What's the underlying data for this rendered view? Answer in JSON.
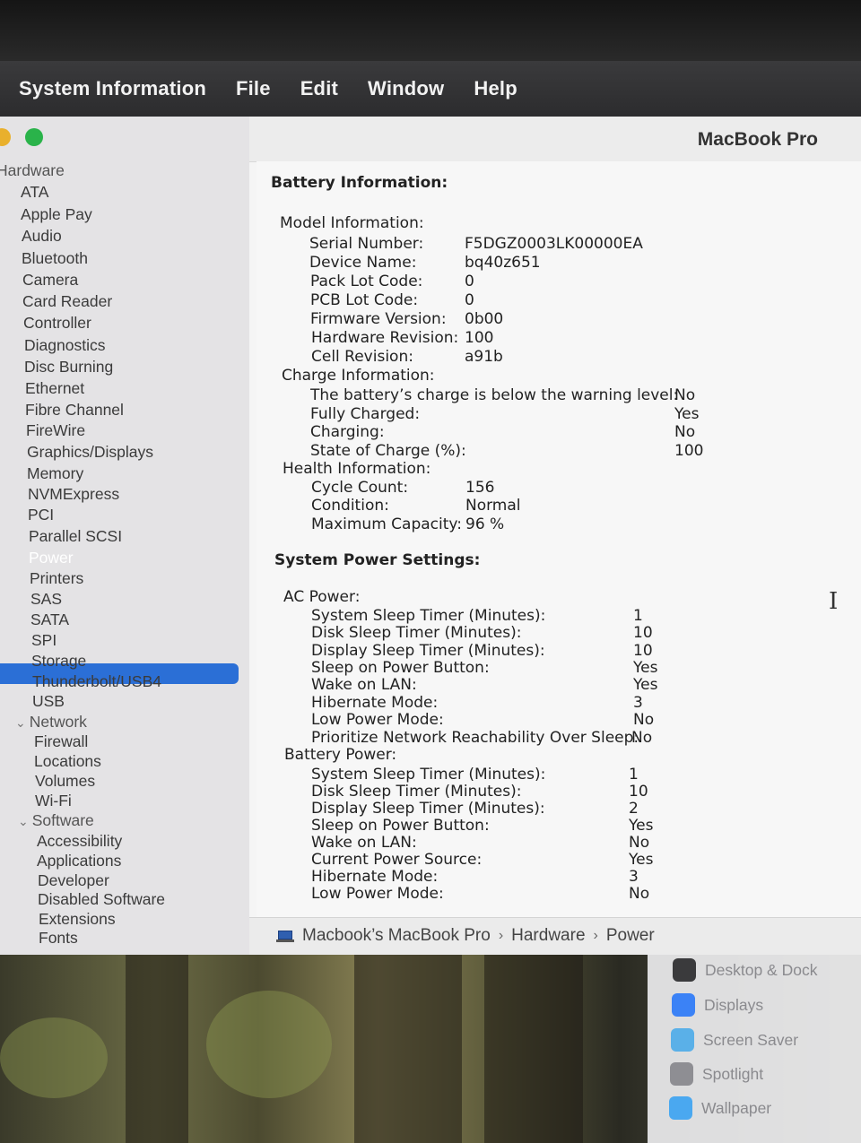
{
  "menubar": {
    "app_name": "System Information",
    "menus": [
      "File",
      "Edit",
      "Window",
      "Help"
    ]
  },
  "window": {
    "title": "MacBook Pro"
  },
  "sidebar": {
    "items": [
      {
        "label": "Hardware",
        "kind": "category"
      },
      {
        "label": "ATA"
      },
      {
        "label": "Apple Pay"
      },
      {
        "label": "Audio"
      },
      {
        "label": "Bluetooth"
      },
      {
        "label": "Camera"
      },
      {
        "label": "Card Reader"
      },
      {
        "label": "Controller"
      },
      {
        "label": "Diagnostics"
      },
      {
        "label": "Disc Burning"
      },
      {
        "label": "Ethernet"
      },
      {
        "label": "Fibre Channel"
      },
      {
        "label": "FireWire"
      },
      {
        "label": "Graphics/Displays"
      },
      {
        "label": "Memory"
      },
      {
        "label": "NVMExpress"
      },
      {
        "label": "PCI"
      },
      {
        "label": "Parallel SCSI"
      },
      {
        "label": "Power",
        "selected": true
      },
      {
        "label": "Printers"
      },
      {
        "label": "SAS"
      },
      {
        "label": "SATA"
      },
      {
        "label": "SPI"
      },
      {
        "label": "Storage"
      },
      {
        "label": "Thunderbolt/USB4"
      },
      {
        "label": "USB"
      },
      {
        "label": "Network",
        "kind": "category"
      },
      {
        "label": "Firewall"
      },
      {
        "label": "Locations"
      },
      {
        "label": "Volumes"
      },
      {
        "label": "Wi-Fi"
      },
      {
        "label": "Software",
        "kind": "category"
      },
      {
        "label": "Accessibility"
      },
      {
        "label": "Applications"
      },
      {
        "label": "Developer"
      },
      {
        "label": "Disabled Software"
      },
      {
        "label": "Extensions"
      },
      {
        "label": "Fonts"
      }
    ]
  },
  "battery": {
    "header": "Battery Information:",
    "model_header": "Model Information:",
    "model": [
      {
        "label": "Serial Number:",
        "value": "F5DGZ0003LK00000EA"
      },
      {
        "label": "Device Name:",
        "value": "bq40z651"
      },
      {
        "label": "Pack Lot Code:",
        "value": "0"
      },
      {
        "label": "PCB Lot Code:",
        "value": "0"
      },
      {
        "label": "Firmware Version:",
        "value": "0b00"
      },
      {
        "label": "Hardware Revision:",
        "value": "100"
      },
      {
        "label": "Cell Revision:",
        "value": "a91b"
      }
    ],
    "charge_header": "Charge Information:",
    "charge": [
      {
        "label": "The battery’s charge is below the warning level:",
        "value": "No"
      },
      {
        "label": "Fully Charged:",
        "value": "Yes"
      },
      {
        "label": "Charging:",
        "value": "No"
      },
      {
        "label": "State of Charge (%):",
        "value": "100"
      }
    ],
    "health_header": "Health Information:",
    "health": [
      {
        "label": "Cycle Count:",
        "value": "156"
      },
      {
        "label": "Condition:",
        "value": "Normal"
      },
      {
        "label": "Maximum Capacity:",
        "value": "96 %"
      }
    ]
  },
  "power": {
    "header": "System Power Settings:",
    "ac_header": "AC Power:",
    "ac": [
      {
        "label": "System Sleep Timer (Minutes):",
        "value": "1"
      },
      {
        "label": "Disk Sleep Timer (Minutes):",
        "value": "10"
      },
      {
        "label": "Display Sleep Timer (Minutes):",
        "value": "10"
      },
      {
        "label": "Sleep on Power Button:",
        "value": "Yes"
      },
      {
        "label": "Wake on LAN:",
        "value": "Yes"
      },
      {
        "label": "Hibernate Mode:",
        "value": "3"
      },
      {
        "label": "Low Power Mode:",
        "value": "No"
      },
      {
        "label": "Prioritize Network Reachability Over Sleep:",
        "value": "No"
      }
    ],
    "battery_header": "Battery Power:",
    "battery": [
      {
        "label": "System Sleep Timer (Minutes):",
        "value": "1"
      },
      {
        "label": "Disk Sleep Timer (Minutes):",
        "value": "10"
      },
      {
        "label": "Display Sleep Timer (Minutes):",
        "value": "2"
      },
      {
        "label": "Sleep on Power Button:",
        "value": "Yes"
      },
      {
        "label": "Wake on LAN:",
        "value": "No"
      },
      {
        "label": "Current Power Source:",
        "value": "Yes"
      },
      {
        "label": "Hibernate Mode:",
        "value": "3"
      },
      {
        "label": "Low Power Mode:",
        "value": "No"
      }
    ]
  },
  "breadcrumb": {
    "computer": "Macbook’s MacBook Pro",
    "section": "Hardware",
    "item": "Power",
    "separator": "›"
  },
  "settings_panel": {
    "items": [
      {
        "label": "Desktop & Dock",
        "icon": "desktop-dock-icon",
        "color": "#3a3a3c"
      },
      {
        "label": "Displays",
        "icon": "displays-icon",
        "color": "#3b82f6"
      },
      {
        "label": "Screen Saver",
        "icon": "screen-saver-icon",
        "color": "#5ab0e8"
      },
      {
        "label": "Spotlight",
        "icon": "spotlight-icon",
        "color": "#8e8e93"
      },
      {
        "label": "Wallpaper",
        "icon": "wallpaper-icon",
        "color": "#4aa8f0"
      }
    ]
  },
  "colors": {
    "selection": "#2b6fd6",
    "traffic_yellow": "#e9b02c",
    "traffic_green": "#2ab34a"
  }
}
